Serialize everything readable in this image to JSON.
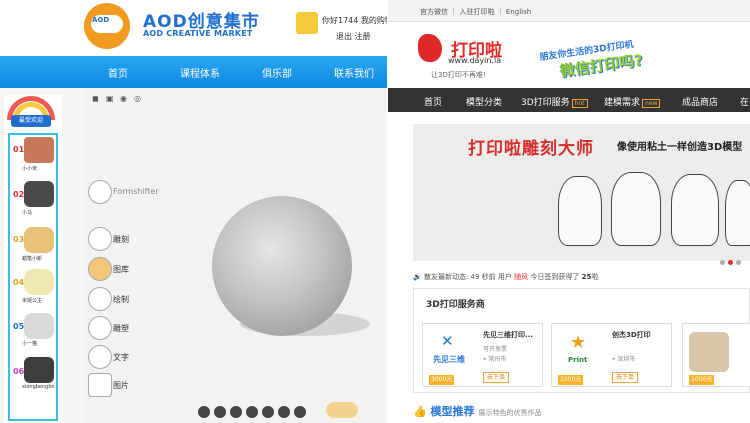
{
  "aod": {
    "title": "AOD创意集市",
    "subtitle": "AOD CREATIVE MARKET",
    "logo_text": "AOD",
    "user_line1": "你好1744 我的购物",
    "user_line2": "退出 注册",
    "nav": [
      "首页",
      "课程体系",
      "俱乐部",
      "联系我们"
    ],
    "popular_label": "最受欢迎",
    "rankings": [
      {
        "num": "01",
        "name": "小小米",
        "color": "#e03030"
      },
      {
        "num": "02",
        "name": "小马",
        "color": "#e03030"
      },
      {
        "num": "03",
        "name": "蜡笔小新",
        "color": "#e0a020"
      },
      {
        "num": "04",
        "name": "米妮公主",
        "color": "#e0a020"
      },
      {
        "num": "05",
        "name": "小一猫",
        "color": "#1e6fd0"
      },
      {
        "num": "06",
        "name": "xiongbengbn",
        "color": "#c040c0"
      }
    ],
    "viewport_toolbar": [
      "◼",
      "▣",
      "◉",
      "◎"
    ],
    "tools": [
      {
        "label": "Formshifter",
        "icon": "formshifter-icon"
      },
      {
        "label": "雕刻",
        "icon": "sculpt-icon"
      },
      {
        "label": "图库",
        "icon": "gallery-icon"
      },
      {
        "label": "绘制",
        "icon": "paint-icon"
      },
      {
        "label": "雕塑",
        "icon": "sculpture-icon"
      },
      {
        "label": "文字",
        "icon": "text-icon"
      },
      {
        "label": "图片",
        "icon": "image-icon"
      }
    ]
  },
  "dayin": {
    "topbar": "官方微信 ｜ 入驻打印啦 ｜ English",
    "logo_title": "打印啦",
    "logo_url": "www.dayin.la",
    "logo_slogan": "让3D打印不再难!",
    "wechat_line1": "朋友你生活的3D打印机",
    "wechat_line2": "微信打印吗?",
    "nav": [
      {
        "label": "首页",
        "tag": ""
      },
      {
        "label": "模型分类",
        "tag": ""
      },
      {
        "label": "3D打印服务",
        "tag": "hot"
      },
      {
        "label": "建模需求",
        "tag": "new"
      },
      {
        "label": "成品商店",
        "tag": ""
      },
      {
        "label": "在",
        "tag": ""
      }
    ],
    "banner_title": "打印啦雕刻大师",
    "banner_subtitle": "像使用粘土一样创造3D模型",
    "news_prefix": "🔊 散友最新动态:",
    "news_time": "49 秒前 用户",
    "news_user": "随风",
    "news_rest": "今日签到获得了",
    "news_amount": "25",
    "news_unit": "啦",
    "services_title": "3D打印服务商",
    "services": [
      {
        "name": "先见三维打印...",
        "note": "可开发票",
        "loc": "常州市",
        "badge": "3000元",
        "btn": "去下单",
        "logo_text": "先见三维"
      },
      {
        "name": "创杰3D打印",
        "note": "",
        "loc": "深圳市",
        "badge": "1000元",
        "btn": "去下单",
        "logo_text": "Print"
      },
      {
        "name": "",
        "note": "",
        "loc": "",
        "badge": "1000元",
        "btn": "",
        "logo_text": ""
      }
    ],
    "model_rec_title": "模型推荐",
    "model_rec_sub": "展示特色的优秀作品"
  }
}
